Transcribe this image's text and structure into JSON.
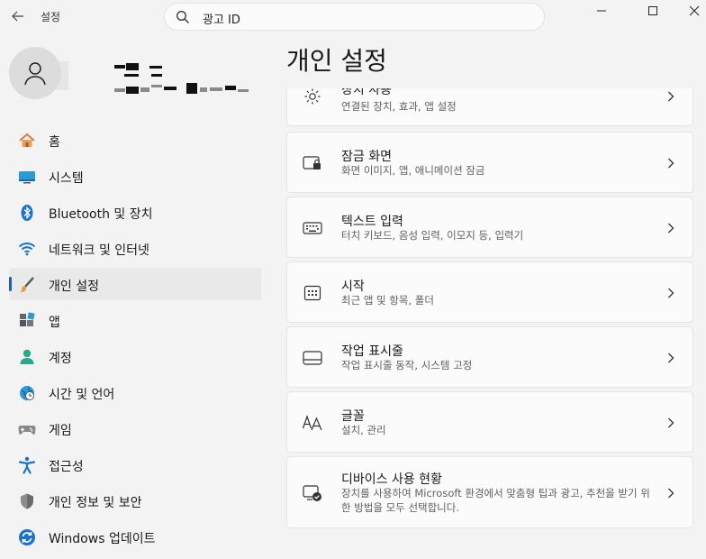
{
  "window": {
    "title": "설정"
  },
  "search": {
    "value": "광고 ID"
  },
  "page": {
    "title": "개인 설정"
  },
  "sidebar": {
    "items": [
      {
        "label": "홈",
        "icon": "home-icon"
      },
      {
        "label": "시스템",
        "icon": "system-icon"
      },
      {
        "label": "Bluetooth 및 장치",
        "icon": "bluetooth-icon"
      },
      {
        "label": "네트워크 및 인터넷",
        "icon": "wifi-icon"
      },
      {
        "label": "개인 설정",
        "icon": "brush-icon",
        "active": true
      },
      {
        "label": "앱",
        "icon": "apps-icon"
      },
      {
        "label": "계정",
        "icon": "account-icon"
      },
      {
        "label": "시간 및 언어",
        "icon": "globe-clock-icon"
      },
      {
        "label": "게임",
        "icon": "gamepad-icon"
      },
      {
        "label": "접근성",
        "icon": "accessibility-icon"
      },
      {
        "label": "개인 정보 및 보안",
        "icon": "shield-icon"
      },
      {
        "label": "Windows 업데이트",
        "icon": "update-icon"
      }
    ]
  },
  "cards": [
    {
      "title": "장치 사용",
      "desc": "연결된 장치, 효과, 앱 설정",
      "icon": "device-usage-icon"
    },
    {
      "title": "잠금 화면",
      "desc": "화면 이미지, 앱, 애니메이션 잠금",
      "icon": "lock-screen-icon"
    },
    {
      "title": "텍스트 입력",
      "desc": "터치 키보드, 음성 입력, 이모지 등, 입력기",
      "icon": "keyboard-icon"
    },
    {
      "title": "시작",
      "desc": "최근 앱 및 항목, 폴더",
      "icon": "start-icon"
    },
    {
      "title": "작업 표시줄",
      "desc": "작업 표시줄 동작, 시스템 고정",
      "icon": "taskbar-icon"
    },
    {
      "title": "글꼴",
      "desc": "설치, 관리",
      "icon": "fonts-icon"
    },
    {
      "title": "디바이스 사용 현황",
      "desc": "장치를 사용하여 Microsoft 환경에서 맞춤형 팁과 광고, 추천을 받기 위한 방법을 모두 선택합니다.",
      "icon": "device-usage-check-icon"
    }
  ],
  "colors": {
    "accent": "#1a5fb4",
    "background": "#f3f3f3",
    "card": "#fbfbfb"
  }
}
